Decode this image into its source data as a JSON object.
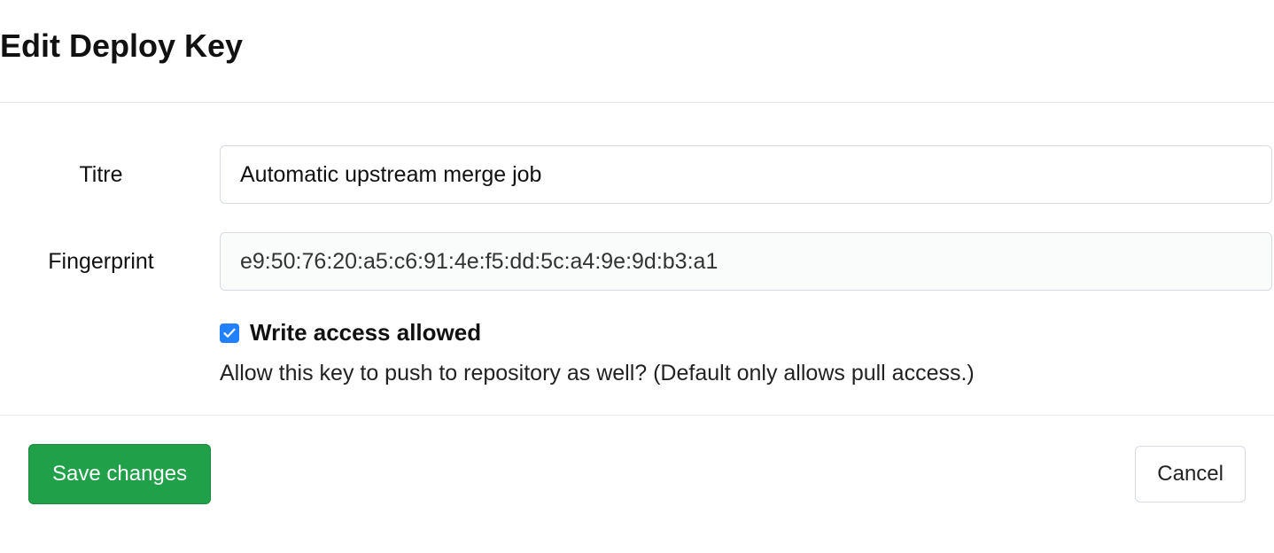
{
  "header": {
    "title": "Edit Deploy Key"
  },
  "form": {
    "title_label": "Titre",
    "title_value": "Automatic upstream merge job",
    "fingerprint_label": "Fingerprint",
    "fingerprint_value": "e9:50:76:20:a5:c6:91:4e:f5:dd:5c:a4:9e:9d:b3:a1",
    "write_access_label": "Write access allowed",
    "write_access_checked": true,
    "write_access_help": "Allow this key to push to repository as well? (Default only allows pull access.)"
  },
  "footer": {
    "save_label": "Save changes",
    "cancel_label": "Cancel"
  }
}
